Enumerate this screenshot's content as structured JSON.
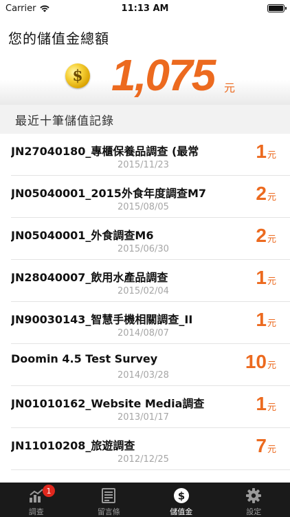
{
  "status_bar": {
    "carrier": "Carrier",
    "time": "11:13 AM"
  },
  "balance": {
    "title": "您的儲值金總額",
    "amount": "1,075",
    "unit": "元",
    "coin_symbol": "$"
  },
  "records_section": {
    "title": "最近十筆儲值記錄"
  },
  "records": [
    {
      "title": "JN27040180_專櫃保養品調查 (最常",
      "date": "2015/11/23",
      "amount": "1",
      "unit": "元"
    },
    {
      "title": "JN05040001_2015外食年度調查M7",
      "date": "2015/08/05",
      "amount": "2",
      "unit": "元"
    },
    {
      "title": "JN05040001_外食調查M6",
      "date": "2015/06/30",
      "amount": "2",
      "unit": "元"
    },
    {
      "title": "JN28040007_飲用水產品調查",
      "date": "2015/02/04",
      "amount": "1",
      "unit": "元"
    },
    {
      "title": "JN90030143_智慧手機相關調查_II",
      "date": "2014/08/07",
      "amount": "1",
      "unit": "元"
    },
    {
      "title": "Doomin 4.5 Test Survey",
      "date": "2014/03/28",
      "amount": "10",
      "unit": "元"
    },
    {
      "title": "JN01010162_Website Media調查",
      "date": "2013/01/17",
      "amount": "1",
      "unit": "元"
    },
    {
      "title": "JN11010208_旅遊調查",
      "date": "2012/12/25",
      "amount": "7",
      "unit": "元"
    }
  ],
  "tab_bar": {
    "tabs": [
      {
        "label": "調查",
        "icon": "chart-icon",
        "badge": "1"
      },
      {
        "label": "留言條",
        "icon": "note-icon"
      },
      {
        "label": "儲值金",
        "icon": "dollar-icon"
      },
      {
        "label": "設定",
        "icon": "gear-icon"
      }
    ],
    "active_index": 2
  },
  "colors": {
    "accent": "#ec6a1f",
    "tab_bar_bg": "#1a1a1a",
    "badge": "#e0281e"
  }
}
